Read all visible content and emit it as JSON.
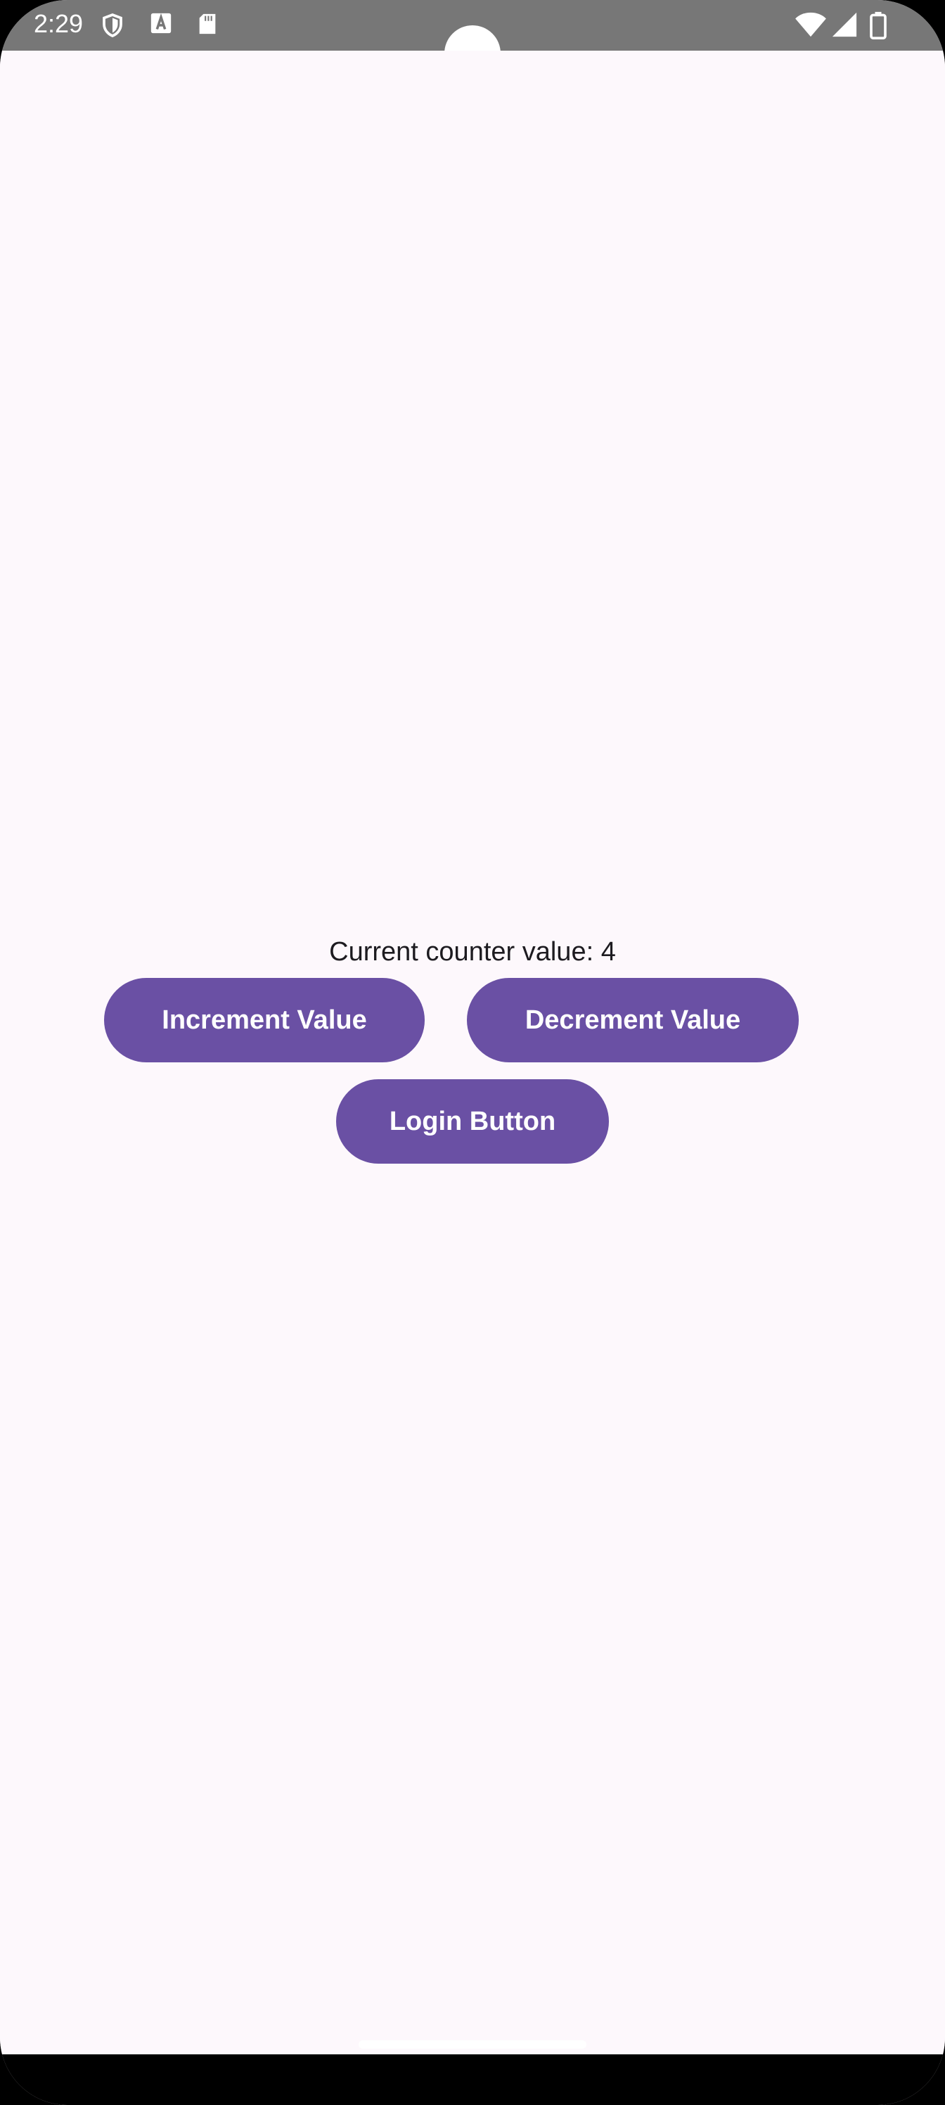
{
  "status_bar": {
    "time": "2:29",
    "left_icons": [
      "shield-icon",
      "text-a-icon",
      "sd-card-icon"
    ],
    "right_icons": [
      "wifi-icon",
      "cellular-signal-icon",
      "battery-icon"
    ]
  },
  "counter": {
    "label": "Current counter value: 4"
  },
  "buttons": {
    "increment": "Increment Value",
    "decrement": "Decrement Value",
    "login": "Login Button"
  },
  "colors": {
    "status_bar": "#777777",
    "background": "#fdf8fc",
    "button": "#6a50a4",
    "button_text": "#ffffff",
    "nav_bar": "#000000"
  }
}
